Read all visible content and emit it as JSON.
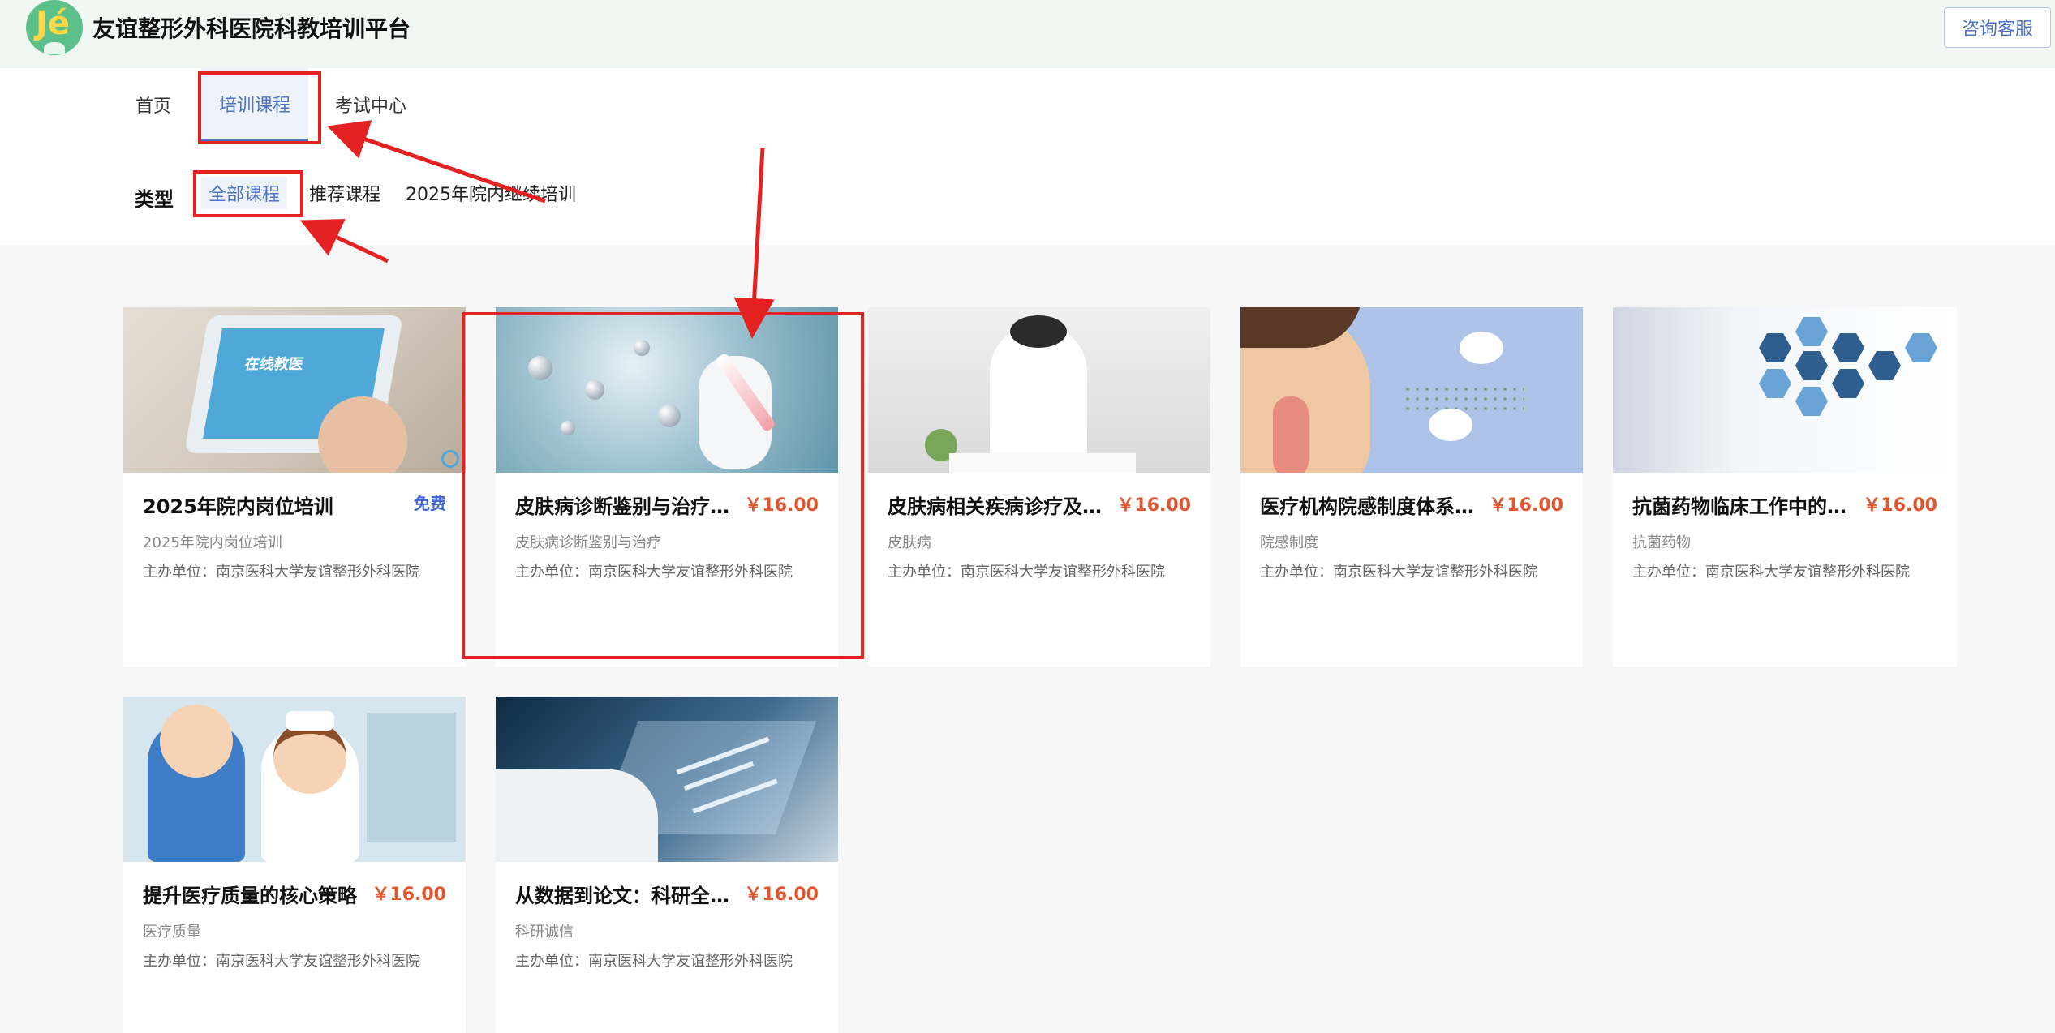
{
  "header": {
    "logo_text": "Jé",
    "site_title": "友谊整形外科医院科教培训平台",
    "consult_label": "咨询客服"
  },
  "nav": {
    "items": [
      {
        "label": "首页"
      },
      {
        "label": "培训课程"
      },
      {
        "label": "考试中心"
      }
    ],
    "active_index": 1
  },
  "filter": {
    "label": "类型",
    "items": [
      {
        "label": "全部课程"
      },
      {
        "label": "推荐课程"
      },
      {
        "label": "2025年院内继续培训"
      }
    ],
    "active_index": 0
  },
  "colors": {
    "accent": "#4f73c6",
    "price": "#e0562f",
    "annotation": "#e52222"
  },
  "courses": [
    {
      "title": "2025年院内岗位培训",
      "price": "免费",
      "category": "2025年院内岗位培训",
      "org": "主办单位：南京医科大学友谊整形外科医院",
      "image_text": "在线教医"
    },
    {
      "title": "皮肤病诊断鉴别与治疗能…",
      "price": "￥16.00",
      "category": "皮肤病诊断鉴别与治疗",
      "org": "主办单位：南京医科大学友谊整形外科医院"
    },
    {
      "title": "皮肤病相关疾病诊疗及其…",
      "price": "￥16.00",
      "category": "皮肤病",
      "org": "主办单位：南京医科大学友谊整形外科医院"
    },
    {
      "title": "医疗机构院感制度体系完…",
      "price": "￥16.00",
      "category": "院感制度",
      "org": "主办单位：南京医科大学友谊整形外科医院"
    },
    {
      "title": "抗菌药物临床工作中的合…",
      "price": "￥16.00",
      "category": "抗菌药物",
      "org": "主办单位：南京医科大学友谊整形外科医院"
    },
    {
      "title": "提升医疗质量的核心策略",
      "price": "￥16.00",
      "category": "医疗质量",
      "org": "主办单位：南京医科大学友谊整形外科医院"
    },
    {
      "title": "从数据到论文：科研全流…",
      "price": "￥16.00",
      "category": "科研诚信",
      "org": "主办单位：南京医科大学友谊整形外科医院"
    }
  ]
}
